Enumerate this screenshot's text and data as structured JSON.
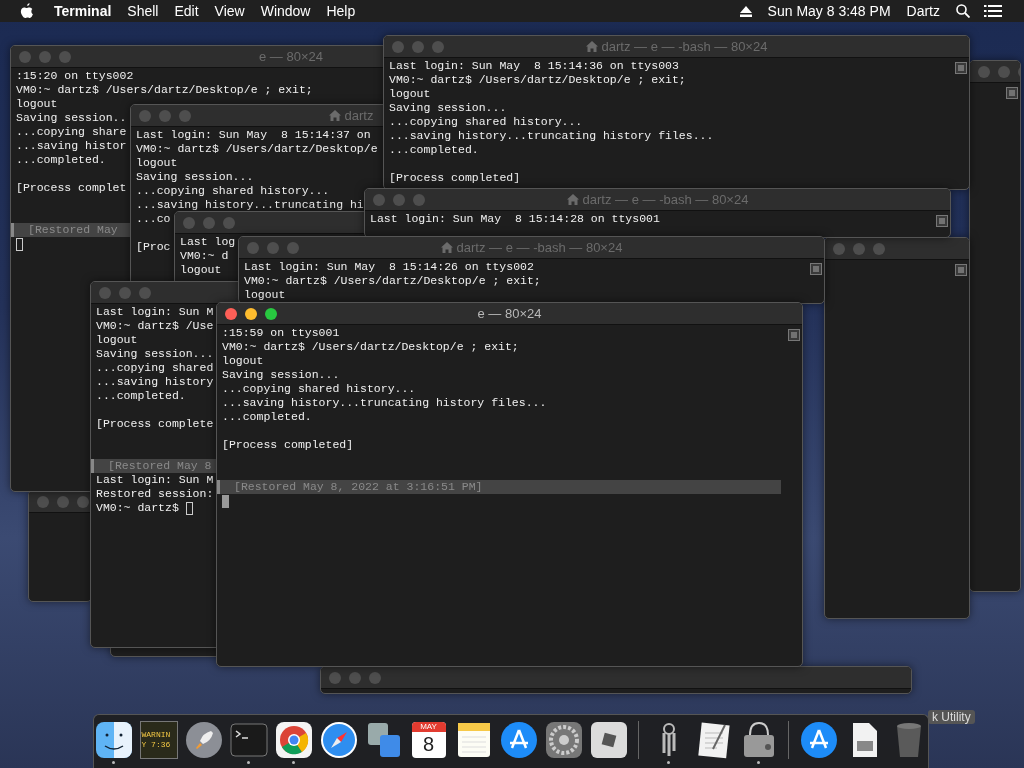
{
  "menu_bar": {
    "app": "Terminal",
    "menus": [
      "Shell",
      "Edit",
      "View",
      "Window",
      "Help"
    ],
    "clock": "Sun May 8  3:48 PM",
    "user": "Dartz"
  },
  "windows": [
    {
      "kind": "blank"
    },
    {
      "kind": "blank"
    },
    {
      "kind": "blank"
    },
    {
      "kind": "blank"
    },
    {
      "kind": "blank"
    },
    {
      "kind": "terminal",
      "active": false,
      "title": "e — 80×24",
      "output": [
        ":15:20 on ttys002",
        "VM0:~ dartz$ /Users/dartz/Desktop/e ; exit;",
        "logout",
        "Saving session..",
        "...copying share",
        "...saving histor",
        "...completed."
      ],
      "status": "[Process complet",
      "restored": "[Restored May",
      "cursor": true
    },
    {
      "kind": "terminal",
      "active": false,
      "title": "dartz",
      "home": true,
      "output": [
        "Last login: Sun May  8 15:14:37 on",
        "VM0:~ dartz$ /Users/dartz/Desktop/e",
        "logout",
        "Saving session...",
        "...copying shared history...",
        "...saving history...truncating hi",
        "...co"
      ],
      "status": "[Proc"
    },
    {
      "kind": "terminal",
      "active": false,
      "output": [
        "Last log",
        "VM0:~ d",
        "logout"
      ]
    },
    {
      "kind": "terminal",
      "active": false,
      "title": "dartz — e — -bash — 80×24",
      "home": true,
      "output": [
        "Last login: Sun May  8 15:14:36 on ttys003",
        "VM0:~ dartz$ /Users/dartz/Desktop/e ; exit;",
        "logout",
        "Saving session...",
        "...copying shared history...",
        "...saving history...truncating history files...",
        "...completed."
      ],
      "status": "[Process completed]"
    },
    {
      "kind": "terminal",
      "active": false,
      "title": "dartz — e — -bash — 80×24",
      "home": true,
      "output": [
        "Last login: Sun May  8 15:14:28 on ttys001"
      ]
    },
    {
      "kind": "terminal",
      "active": false,
      "output": [
        "Last login: Sun M",
        "VM0:~ dartz$ /Use",
        "logout",
        "Saving session...",
        "...copying shared",
        "...saving history",
        "...completed."
      ],
      "status": "[Process complete",
      "restored": "[Restored May 8",
      "after": [
        "Last login: Sun M",
        "Restored session:",
        "VM0:~ dartz$"
      ],
      "cursor": true
    },
    {
      "kind": "terminal",
      "active": false,
      "title": "dartz — e — -bash — 80×24",
      "home": true,
      "output": [
        "Last login: Sun May  8 15:14:26 on ttys002",
        "VM0:~ dartz$ /Users/dartz/Desktop/e ; exit;",
        "logout"
      ]
    },
    {
      "kind": "terminal",
      "active": true,
      "title": "e — 80×24",
      "output": [
        ":15:59 on ttys001",
        "VM0:~ dartz$ /Users/dartz/Desktop/e ; exit;",
        "logout",
        "Saving session...",
        "...copying shared history...",
        "...saving history...truncating history files...",
        "...completed."
      ],
      "status": "[Process completed]",
      "restored": "[Restored May 8, 2022 at 3:16:51 PM]",
      "cursor": true
    }
  ],
  "desktop_label": "k Utility",
  "dock": [
    {
      "kind": "finder",
      "running": true
    },
    {
      "kind": "console",
      "lines": [
        "WARNIN",
        "Y 7:36"
      ],
      "running": false
    },
    {
      "kind": "rocket",
      "running": false
    },
    {
      "kind": "terminal",
      "running": true
    },
    {
      "kind": "chrome",
      "running": true
    },
    {
      "kind": "safari",
      "running": false
    },
    {
      "kind": "migration",
      "running": false
    },
    {
      "kind": "calendar",
      "month": "MAY",
      "day": "8",
      "running": false
    },
    {
      "kind": "notes",
      "running": false
    },
    {
      "kind": "appstore",
      "running": false
    },
    {
      "kind": "gear",
      "running": false
    },
    {
      "kind": "cube",
      "running": false
    },
    {
      "kind": "separator"
    },
    {
      "kind": "keys",
      "running": true
    },
    {
      "kind": "textedit",
      "running": false
    },
    {
      "kind": "diskutil",
      "running": true
    },
    {
      "kind": "separator"
    },
    {
      "kind": "appstore",
      "running": false
    },
    {
      "kind": "file",
      "running": false
    },
    {
      "kind": "trash",
      "running": false
    }
  ]
}
